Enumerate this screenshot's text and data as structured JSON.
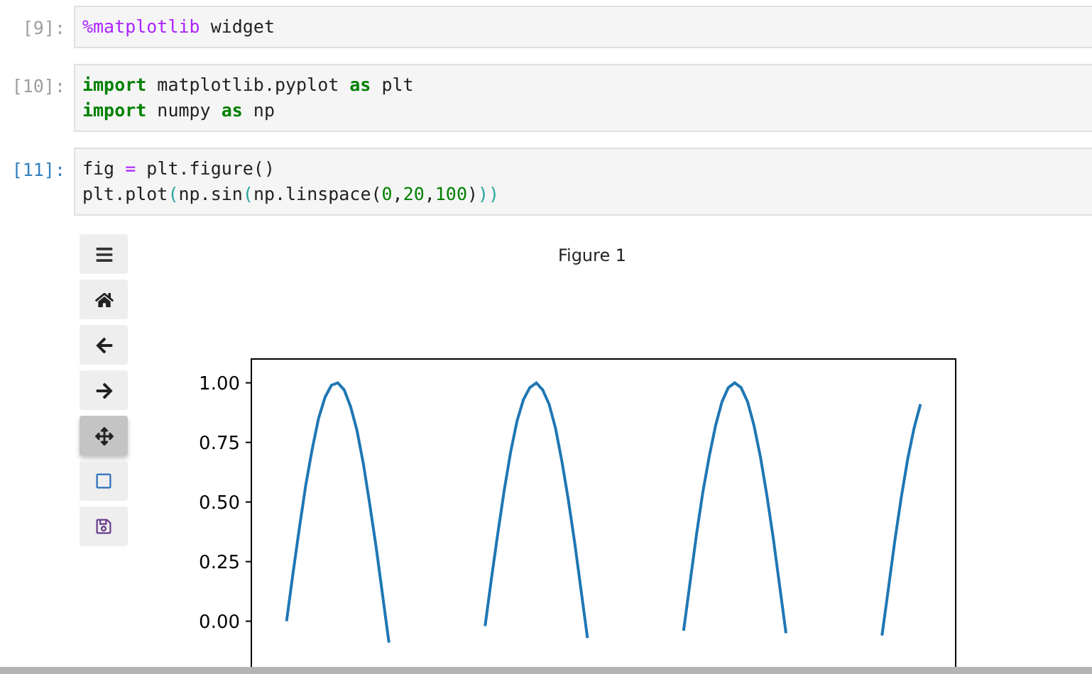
{
  "cells": [
    {
      "prompt": "[9]:",
      "active": false,
      "lines": [
        [
          {
            "text": "%matplotlib",
            "kind": "magic"
          },
          {
            "text": " widget",
            "kind": "plain"
          }
        ]
      ]
    },
    {
      "prompt": "[10]:",
      "active": false,
      "lines": [
        [
          {
            "text": "import",
            "kind": "keyword"
          },
          {
            "text": " matplotlib.pyplot ",
            "kind": "plain"
          },
          {
            "text": "as",
            "kind": "keyword"
          },
          {
            "text": " plt",
            "kind": "plain"
          }
        ],
        [
          {
            "text": "import",
            "kind": "keyword"
          },
          {
            "text": " numpy ",
            "kind": "plain"
          },
          {
            "text": "as",
            "kind": "keyword"
          },
          {
            "text": " np",
            "kind": "plain"
          }
        ]
      ]
    },
    {
      "prompt": "[11]:",
      "active": true,
      "lines": [
        [
          {
            "text": "fig ",
            "kind": "plain"
          },
          {
            "text": "=",
            "kind": "operator"
          },
          {
            "text": " plt.figure()",
            "kind": "plain"
          }
        ],
        [
          {
            "text": "plt.plot",
            "kind": "plain"
          },
          {
            "text": "(",
            "kind": "bracket"
          },
          {
            "text": "np.sin",
            "kind": "plain"
          },
          {
            "text": "(",
            "kind": "bracket"
          },
          {
            "text": "np.linspace(",
            "kind": "plain"
          },
          {
            "text": "0",
            "kind": "number"
          },
          {
            "text": ",",
            "kind": "plain"
          },
          {
            "text": "20",
            "kind": "number"
          },
          {
            "text": ",",
            "kind": "plain"
          },
          {
            "text": "100",
            "kind": "number"
          },
          {
            "text": ")",
            "kind": "plain"
          },
          {
            "text": "))",
            "kind": "bracket"
          }
        ]
      ]
    }
  ],
  "figure": {
    "toolbar": [
      {
        "kind": "menu",
        "selected": false
      },
      {
        "kind": "home",
        "selected": false
      },
      {
        "kind": "back",
        "selected": false
      },
      {
        "kind": "forward",
        "selected": false
      },
      {
        "kind": "pan",
        "selected": true
      },
      {
        "kind": "zoom",
        "selected": false
      },
      {
        "kind": "save",
        "selected": false
      }
    ],
    "title": "Figure 1",
    "chart_data": {
      "type": "line",
      "ylim": [
        -0.22,
        1.1
      ],
      "categories": [
        null,
        null,
        null,
        null,
        null,
        null,
        null,
        null,
        null,
        null,
        null,
        null,
        null,
        null,
        null,
        null,
        null,
        null,
        null,
        null,
        null,
        null,
        null,
        null,
        null,
        null,
        null,
        null,
        null,
        null,
        null,
        null,
        null,
        null,
        null,
        null,
        null,
        null,
        null,
        null,
        null,
        null,
        null,
        null,
        null,
        null,
        null,
        null,
        null,
        null,
        null,
        null,
        null,
        null,
        null,
        null,
        null,
        null,
        null,
        null,
        null,
        null,
        null,
        null,
        null,
        null,
        null,
        null,
        null,
        null,
        null,
        null,
        null,
        null,
        null,
        null,
        null,
        null,
        null,
        null,
        null,
        null,
        null,
        null,
        null,
        null,
        null,
        null,
        null,
        null,
        null,
        null,
        null,
        null,
        null,
        null,
        null,
        null,
        null,
        null,
        null,
        null,
        null,
        null,
        null,
        null,
        null,
        null,
        null,
        null
      ],
      "yticks": [
        {
          "value": 0,
          "label": "0.00"
        },
        {
          "value": 0.25,
          "label": "0.25"
        },
        {
          "value": 0.5,
          "label": "0.50"
        },
        {
          "value": 0.75,
          "label": "0.75"
        },
        {
          "value": 1,
          "label": "1.00"
        }
      ],
      "series": [
        {
          "color": "#1f77b4",
          "values": [
            null,
            null,
            null,
            null,
            null,
            0,
            0.2,
            0.39,
            0.57,
            0.72,
            0.85,
            0.94,
            0.99,
            1,
            0.97,
            0.9,
            0.8,
            0.66,
            0.49,
            0.31,
            0.11,
            -0.09,
            null,
            null,
            null,
            null,
            null,
            null,
            null,
            null,
            null,
            null,
            null,
            null,
            null,
            null,
            -0.02,
            0.18,
            0.37,
            0.55,
            0.71,
            0.84,
            0.93,
            0.98,
            1,
            0.97,
            0.91,
            0.81,
            0.67,
            0.51,
            0.33,
            0.13,
            -0.07,
            null,
            null,
            null,
            null,
            null,
            null,
            null,
            null,
            null,
            null,
            null,
            null,
            null,
            null,
            -0.04,
            0.16,
            0.36,
            0.54,
            0.69,
            0.82,
            0.92,
            0.98,
            1,
            0.98,
            0.92,
            0.82,
            0.69,
            0.53,
            0.35,
            0.15,
            -0.05,
            null,
            null,
            null,
            null,
            null,
            null,
            null,
            null,
            null,
            null,
            null,
            null,
            null,
            null,
            -0.06,
            0.14,
            0.34,
            0.52,
            0.68,
            0.81,
            0.91,
            null,
            null,
            null,
            null,
            null
          ]
        }
      ]
    }
  }
}
